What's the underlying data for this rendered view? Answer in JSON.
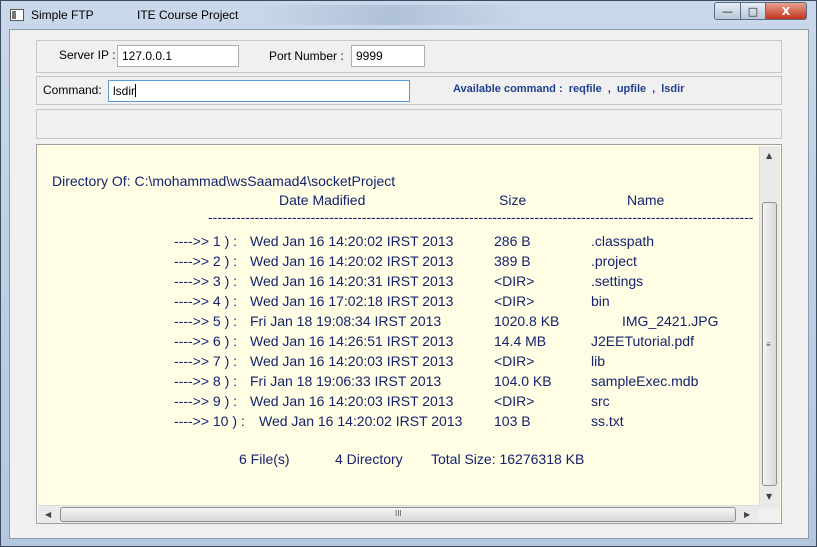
{
  "window": {
    "title": "Simple FTP",
    "subtitle": "ITE Course Project",
    "controls": {
      "minimize": "—",
      "maximize": "□",
      "close": "X"
    }
  },
  "server": {
    "ip_label": "Server IP :",
    "ip_value": "127.0.0.1",
    "port_label": "Port Number :",
    "port_value": "9999"
  },
  "command": {
    "label": "Command:",
    "value": "lsdir",
    "available_label": "Available command :",
    "commands": [
      "reqfile",
      "upfile",
      "lsdir"
    ],
    "separator": ","
  },
  "listing": {
    "directory_line": "Directory Of: C:\\mohammad\\wsSaamad4\\socketProject",
    "headers": {
      "date": "Date Madified",
      "size": "Size",
      "name": "Name"
    },
    "divider": "-----------------------------------------------------------------------------------------------------------------------",
    "rows": [
      {
        "index": "---->> 1 ) :",
        "date": "Wed Jan 16 14:20:02 IRST 2013",
        "size": "286 B",
        "name": ".classpath"
      },
      {
        "index": "---->> 2 ) :",
        "date": "Wed Jan 16 14:20:02 IRST 2013",
        "size": "389 B",
        "name": ".project"
      },
      {
        "index": "---->> 3 ) :",
        "date": "Wed Jan 16 14:20:31 IRST 2013",
        "size": "<DIR>",
        "name": ".settings"
      },
      {
        "index": "---->> 4 ) :",
        "date": "Wed Jan 16 17:02:18 IRST 2013",
        "size": "<DIR>",
        "name": "bin"
      },
      {
        "index": "---->> 5 ) :",
        "date": "Fri Jan 18 19:08:34 IRST 2013",
        "size": "1020.8 KB",
        "name": "IMG_2421.JPG"
      },
      {
        "index": "---->> 6 ) :",
        "date": "Wed Jan 16 14:26:51 IRST 2013",
        "size": "14.4 MB",
        "name": "J2EETutorial.pdf"
      },
      {
        "index": "---->> 7 ) :",
        "date": "Wed Jan 16 14:20:03 IRST 2013",
        "size": "<DIR>",
        "name": "lib"
      },
      {
        "index": "---->> 8 ) :",
        "date": "Fri Jan 18 19:06:33 IRST 2013",
        "size": "104.0 KB",
        "name": "sampleExec.mdb"
      },
      {
        "index": "---->> 9 ) :",
        "date": "Wed Jan 16 14:20:03 IRST 2013",
        "size": "<DIR>",
        "name": "src"
      },
      {
        "index": "---->> 10 ) :",
        "date": "Wed Jan 16 14:20:02 IRST 2013",
        "size": "103 B",
        "name": "ss.txt"
      }
    ],
    "summary": {
      "files": "6 File(s)",
      "dirs": "4 Directory",
      "total": "Total Size: 16276318 KB"
    }
  },
  "scroll": {
    "grip": "≡",
    "hgrip": "III",
    "up": "▲",
    "down": "▼",
    "left": "◀",
    "right": "▶"
  },
  "colors": {
    "listing_bg": "#fffee4",
    "listing_text": "#15226e",
    "available_text": "#1f3f8f"
  }
}
